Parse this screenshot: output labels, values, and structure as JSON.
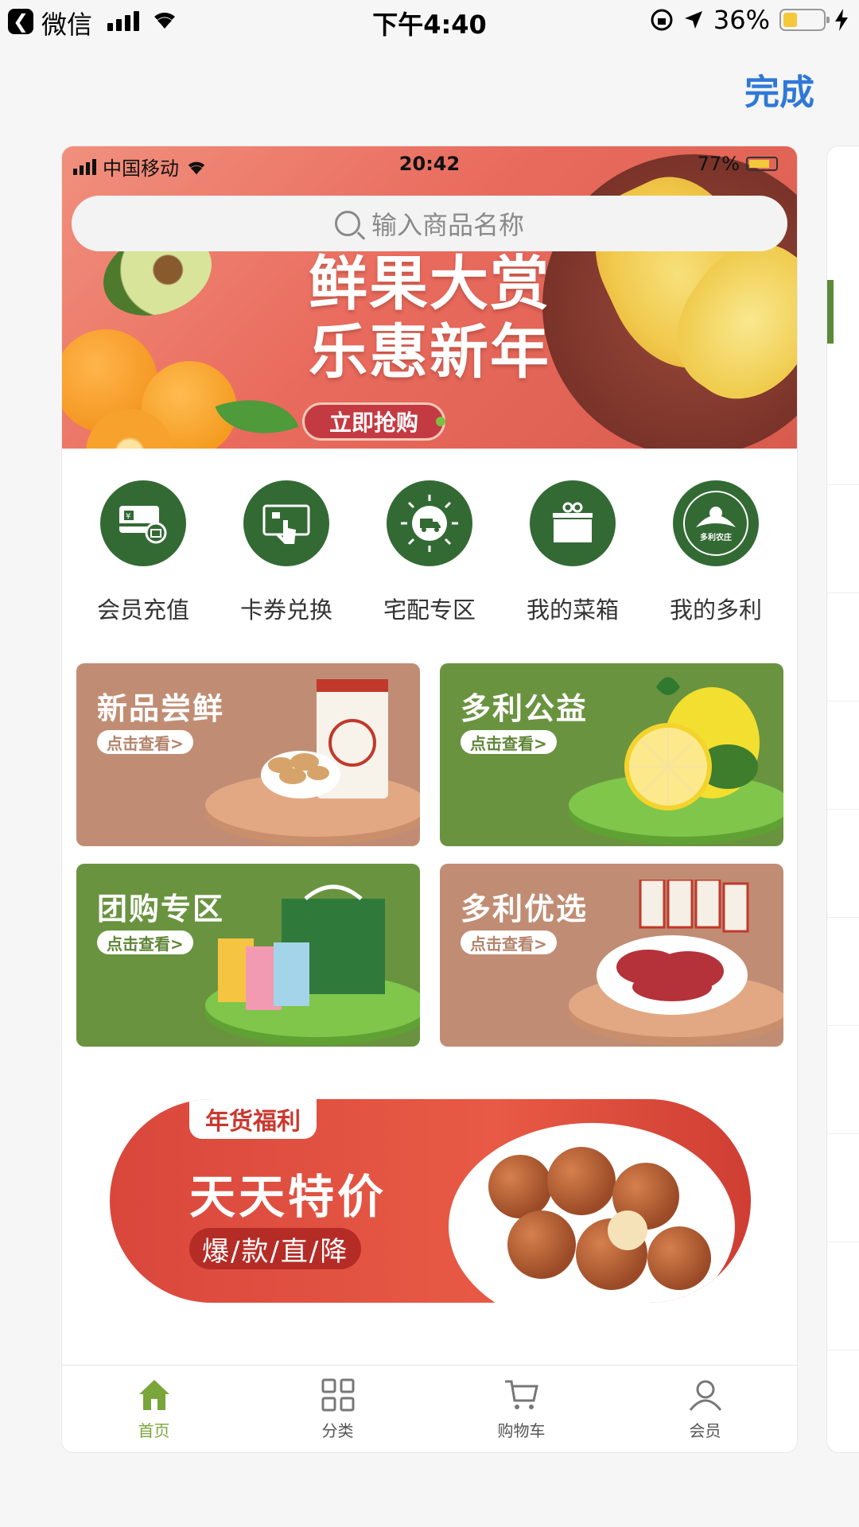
{
  "os_status": {
    "back_app": "微信",
    "time": "下午4:40",
    "battery": "36%"
  },
  "header": {
    "done_label": "完成"
  },
  "phone": {
    "status": {
      "carrier": "中国移动",
      "time": "20:42",
      "battery": "77%"
    },
    "search": {
      "placeholder": "输入商品名称"
    },
    "hero": {
      "title_line1": "鲜果大赏",
      "title_line2": "乐惠新年",
      "button_label": "立即抢购"
    },
    "menu": [
      {
        "label": "会员充值",
        "icon": "card-icon"
      },
      {
        "label": "卡券兑换",
        "icon": "touch-screen-icon"
      },
      {
        "label": "宅配专区",
        "icon": "delivery-truck-icon"
      },
      {
        "label": "我的菜箱",
        "icon": "gift-box-icon"
      },
      {
        "label": "我的多利",
        "icon": "farm-logo-icon"
      }
    ],
    "farm_logo_text": "多利农庄",
    "tiles": [
      {
        "title": "新品尝鲜",
        "link": "点击查看>"
      },
      {
        "title": "多利公益",
        "link": "点击查看>"
      },
      {
        "title": "团购专区",
        "link": "点击查看>"
      },
      {
        "title": "多利优选",
        "link": "点击查看>"
      }
    ],
    "promo": {
      "tag": "年货福利",
      "title": "天天特价",
      "subtitle": "爆/款/直/降"
    },
    "tabbar": [
      {
        "label": "首页",
        "icon": "home-icon",
        "active": true
      },
      {
        "label": "分类",
        "icon": "grid-icon",
        "active": false
      },
      {
        "label": "购物车",
        "icon": "cart-icon",
        "active": false
      },
      {
        "label": "会员",
        "icon": "user-icon",
        "active": false
      }
    ]
  },
  "colors": {
    "accent_green": "#336a34",
    "done_blue": "#2f78d8",
    "tab_active": "#7aa53a"
  }
}
